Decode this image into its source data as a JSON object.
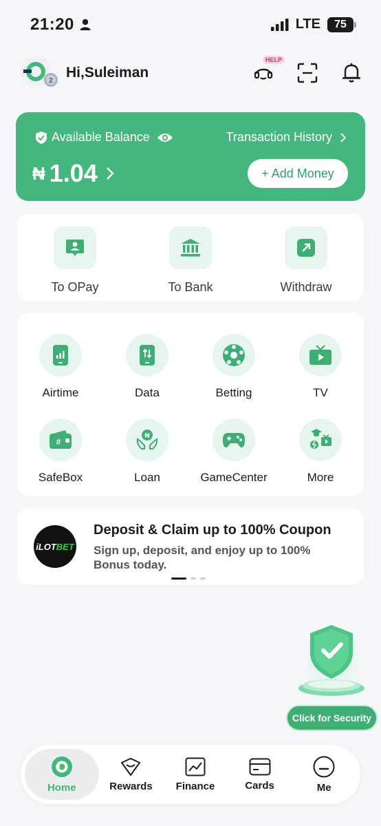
{
  "status_bar": {
    "time": "21:20",
    "network": "LTE",
    "battery": "75"
  },
  "header": {
    "greeting": "Hi,Suleiman",
    "help_badge": "HELP",
    "avatar_level": "2"
  },
  "balance": {
    "label": "Available Balance",
    "history_label": "Transaction History",
    "currency": "₦",
    "amount": "1.04",
    "add_money_label": "+ Add Money"
  },
  "transfers": [
    {
      "label": "To OPay",
      "icon": "person-card-icon"
    },
    {
      "label": "To Bank",
      "icon": "bank-icon"
    },
    {
      "label": "Withdraw",
      "icon": "withdraw-arrow-icon"
    }
  ],
  "services": [
    {
      "label": "Airtime",
      "icon": "phone-signal-icon"
    },
    {
      "label": "Data",
      "icon": "phone-data-icon"
    },
    {
      "label": "Betting",
      "icon": "football-icon"
    },
    {
      "label": "TV",
      "icon": "tv-icon"
    },
    {
      "label": "SafeBox",
      "icon": "wallet-icon"
    },
    {
      "label": "Loan",
      "icon": "hands-coin-icon"
    },
    {
      "label": "GameCenter",
      "icon": "gamepad-icon"
    },
    {
      "label": "More",
      "icon": "more-icon"
    }
  ],
  "promo": {
    "logo_text_a": "iLOT",
    "logo_text_b": "BET",
    "title": "Deposit & Claim up to 100% Coupon",
    "subtitle": "Sign up, deposit, and enjoy up to 100% Bonus today.",
    "pages": 3,
    "active_page": 1
  },
  "security": {
    "label": "Click for Security"
  },
  "nav": [
    {
      "label": "Home",
      "icon": "home-icon",
      "active": true
    },
    {
      "label": "Rewards",
      "icon": "rewards-icon",
      "active": false
    },
    {
      "label": "Finance",
      "icon": "finance-icon",
      "active": false
    },
    {
      "label": "Cards",
      "icon": "cards-icon",
      "active": false
    },
    {
      "label": "Me",
      "icon": "me-icon",
      "active": false
    }
  ],
  "colors": {
    "accent": "#43b77e",
    "tile_bg": "#e6f5ee",
    "page_bg": "#f5f6fa"
  }
}
